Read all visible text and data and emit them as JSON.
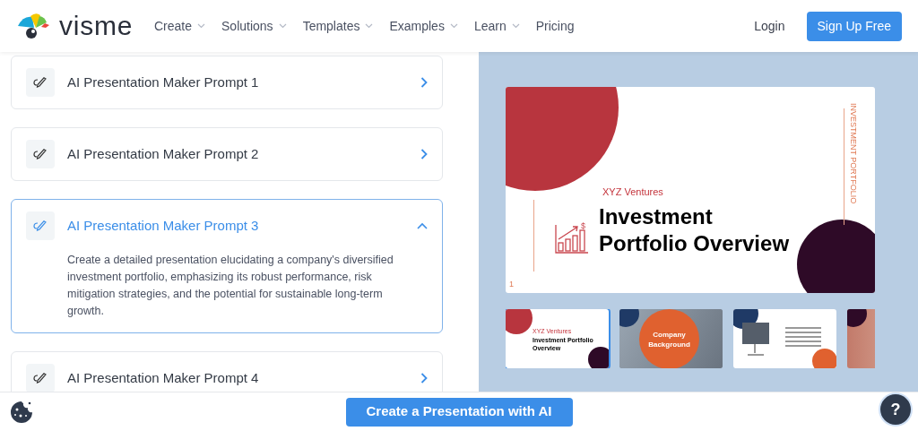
{
  "header": {
    "logo_text": "visme",
    "nav": [
      {
        "label": "Create",
        "dropdown": true
      },
      {
        "label": "Solutions",
        "dropdown": true
      },
      {
        "label": "Templates",
        "dropdown": true
      },
      {
        "label": "Examples",
        "dropdown": true
      },
      {
        "label": "Learn",
        "dropdown": true
      },
      {
        "label": "Pricing",
        "dropdown": false
      }
    ],
    "login": "Login",
    "signup": "Sign Up Free"
  },
  "prompts": [
    {
      "title": "AI Presentation Maker Prompt 1",
      "expanded": false
    },
    {
      "title": "AI Presentation Maker Prompt 2",
      "expanded": false
    },
    {
      "title": "AI Presentation Maker Prompt 3",
      "expanded": true,
      "body": "Create a detailed presentation elucidating a company's diversified investment portfolio, emphasizing its robust performance, risk mitigation strategies, and the potential for sustainable long-term growth."
    },
    {
      "title": "AI Presentation Maker Prompt 4",
      "expanded": false
    }
  ],
  "slide": {
    "company": "XYZ Ventures",
    "title": "Investment Portfolio Overview",
    "side_label": "INVESTMENT PORTFOLIO",
    "page": "1",
    "icon_symbol": "$"
  },
  "thumbnails": [
    {
      "kind": "title",
      "selected": true,
      "company": "XYZ Ventures",
      "title": "Investment Portfolio Overview"
    },
    {
      "kind": "photo",
      "selected": false,
      "title": "Company Background"
    },
    {
      "kind": "list",
      "selected": false
    },
    {
      "kind": "gradient",
      "selected": false
    }
  ],
  "cta": "Create a Presentation with AI",
  "help": "?"
}
